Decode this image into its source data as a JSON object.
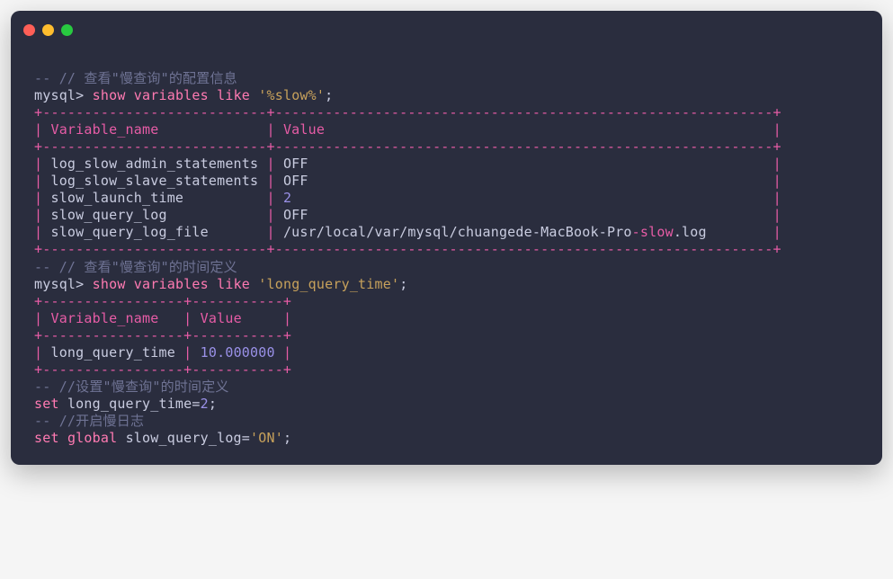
{
  "comments": {
    "c1": "-- // 查看\"慢查询\"的配置信息",
    "c2": "-- // 查看\"慢查询\"的时间定义",
    "c3": "-- //设置\"慢查询\"的时间定义",
    "c4": "-- //开启慢日志"
  },
  "prompts": {
    "p1_prefix": "mysql> ",
    "p2_prefix": "mysql> "
  },
  "queries": {
    "q1_kw1": "show",
    "q1_kw2": "variables",
    "q1_kw3": "like",
    "q1_str": "'%slow%'",
    "q1_end": ";",
    "q2_kw1": "show",
    "q2_kw2": "variables",
    "q2_kw3": "like",
    "q2_str": "'long_query_time'",
    "q2_end": ";",
    "q3_kw1": "set",
    "q3_ident": "long_query_time",
    "q3_eq": "=",
    "q3_val": "2",
    "q3_end": ";",
    "q4_kw1": "set",
    "q4_kw2": "global",
    "q4_ident": "slow_query_log",
    "q4_eq": "=",
    "q4_str": "'ON'",
    "q4_end": ";"
  },
  "table1": {
    "sep": "+---------------------------+------------------------------------------------------------+",
    "head_open": "| ",
    "head_c1": "Variable_name",
    "head_c1_pad": "             ",
    "head_mid": "| ",
    "head_c2": "Value",
    "head_c2_pad": "                                                      ",
    "head_close": "|",
    "rows": [
      {
        "name": "log_slow_admin_statements",
        "pad1": " ",
        "value": "OFF",
        "pad2": "                                                        "
      },
      {
        "name": "log_slow_slave_statements",
        "pad1": " ",
        "value": "OFF",
        "pad2": "                                                        "
      },
      {
        "name": "slow_launch_time",
        "pad1": "          ",
        "value_num": "2",
        "pad2": "                                                          "
      },
      {
        "name": "slow_query_log",
        "pad1": "            ",
        "value": "OFF",
        "pad2": "                                                        "
      },
      {
        "name_pre": "slow_query_log_file",
        "pad1": "       ",
        "value_pre": "/usr/local/var/mysql/chuangede-MacBook-Pro",
        "value_hl": "-slow",
        "value_post": ".log",
        "pad2": "        "
      }
    ]
  },
  "table2": {
    "sep": "+-----------------+-----------+",
    "head_open": "| ",
    "head_c1": "Variable_name",
    "head_c1_pad": "   ",
    "head_mid": "| ",
    "head_c2": "Value",
    "head_c2_pad": "     ",
    "head_close": "|",
    "row_open": "| ",
    "row_name": "long_query_time",
    "row_pad1": " ",
    "row_mid": "| ",
    "row_val": "10.000000",
    "row_pad2": " ",
    "row_close": "|"
  }
}
